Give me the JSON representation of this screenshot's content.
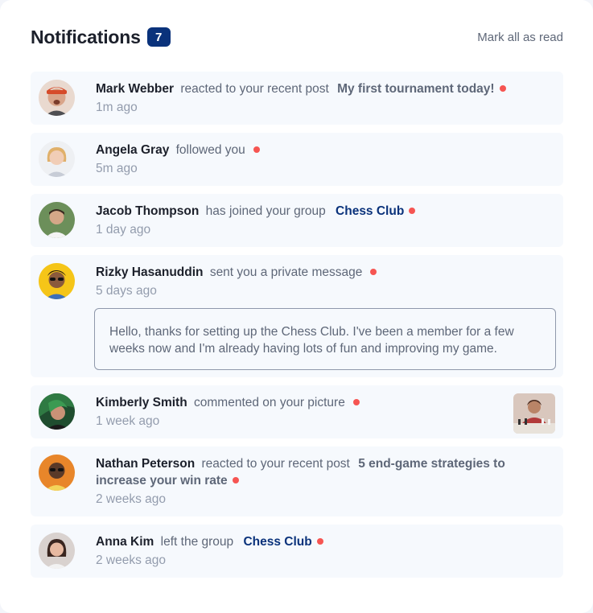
{
  "header": {
    "title": "Notifications",
    "unread_count": "7",
    "mark_all_label": "Mark all as read"
  },
  "notifications": [
    {
      "name": "Mark Webber",
      "action": "reacted to your recent post",
      "post": "My first tournament today!",
      "time": "1m ago",
      "unread": true,
      "avatar_icon": "avatar-mark-webber"
    },
    {
      "name": "Angela Gray",
      "action": "followed you",
      "time": "5m ago",
      "unread": true,
      "avatar_icon": "avatar-angela-gray"
    },
    {
      "name": "Jacob Thompson",
      "action": "has joined your group",
      "group": "Chess Club",
      "time": "1 day ago",
      "unread": true,
      "avatar_icon": "avatar-jacob-thompson"
    },
    {
      "name": "Rizky Hasanuddin",
      "action": "sent you a private message",
      "time": "5 days ago",
      "message": "Hello, thanks for setting up the Chess Club. I've been a member for a few weeks now and I'm already having lots of fun and improving my game.",
      "unread": true,
      "avatar_icon": "avatar-rizky-hasanuddin"
    },
    {
      "name": "Kimberly Smith",
      "action": "commented on your picture",
      "time": "1 week ago",
      "unread": true,
      "avatar_icon": "avatar-kimberly-smith",
      "thumbnail_icon": "chess-picture-thumbnail"
    },
    {
      "name": "Nathan Peterson",
      "action": "reacted to your recent post",
      "post": "5 end-game strategies to increase your win rate",
      "time": "2 weeks ago",
      "unread": true,
      "avatar_icon": "avatar-nathan-peterson"
    },
    {
      "name": "Anna Kim",
      "action": "left the group",
      "group": "Chess Club",
      "time": "2 weeks ago",
      "unread": true,
      "avatar_icon": "avatar-anna-kim"
    }
  ],
  "colors": {
    "badge": "#0a327b",
    "group_link": "#0a327b",
    "unread_dot": "#f65552",
    "item_background": "#f6f9fd"
  }
}
